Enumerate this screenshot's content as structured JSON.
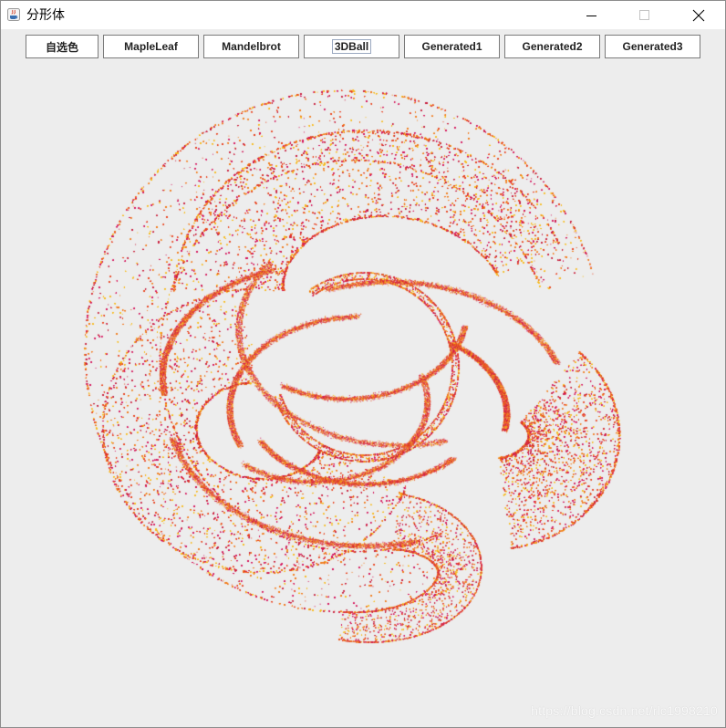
{
  "window": {
    "title": "分形体"
  },
  "toolbar": {
    "buttons": [
      {
        "label": "自选色"
      },
      {
        "label": "MapleLeaf"
      },
      {
        "label": "Mandelbrot"
      },
      {
        "label": "3DBall"
      },
      {
        "label": "Generated1"
      },
      {
        "label": "Generated2"
      },
      {
        "label": "Generated3"
      }
    ],
    "focused": "3DBall"
  },
  "canvas": {
    "background": "#ededed",
    "point_colors": [
      "#e8401c",
      "#f07a1a",
      "#f6b91a",
      "#c81e3c",
      "#d4145a"
    ]
  },
  "watermark": "https://blog.csdn.net/rlc1998210",
  "icons": {
    "app": "java-coffee-cup-icon",
    "minimize": "minimize-icon",
    "maximize": "maximize-icon",
    "close": "close-icon"
  }
}
